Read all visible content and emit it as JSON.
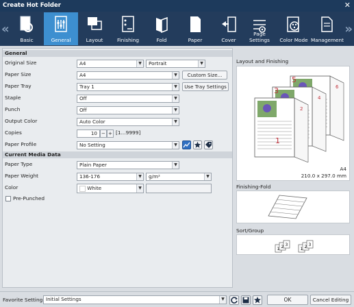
{
  "window": {
    "title": "Create Hot Folder"
  },
  "toolbar": {
    "items": [
      {
        "label": "Basic"
      },
      {
        "label": "General"
      },
      {
        "label": "Layout"
      },
      {
        "label": "Finishing"
      },
      {
        "label": "Fold"
      },
      {
        "label": "Paper"
      },
      {
        "label": "Cover"
      },
      {
        "label": "Page Settings"
      },
      {
        "label": "Color Mode"
      },
      {
        "label": "Management"
      }
    ],
    "active": "General"
  },
  "general": {
    "heading": "General",
    "original_size": {
      "label": "Original Size",
      "value": "A4",
      "orientation": "Portrait"
    },
    "paper_size": {
      "label": "Paper Size",
      "value": "A4",
      "button": "Custom Size..."
    },
    "paper_tray": {
      "label": "Paper Tray",
      "value": "Tray 1",
      "button": "Use Tray Settings"
    },
    "staple": {
      "label": "Staple",
      "value": "Off"
    },
    "punch": {
      "label": "Punch",
      "value": "Off"
    },
    "output_color": {
      "label": "Output Color",
      "value": "Auto Color"
    },
    "copies": {
      "label": "Copies",
      "value": "10",
      "minus": "−",
      "plus": "+",
      "range": "[1...9999]"
    },
    "paper_profile": {
      "label": "Paper Profile",
      "value": "No Setting"
    }
  },
  "media": {
    "heading": "Current Media Data",
    "paper_type": {
      "label": "Paper Type",
      "value": "Plain Paper"
    },
    "paper_weight": {
      "label": "Paper Weight",
      "value": "136-176",
      "unit": "g/m²"
    },
    "color": {
      "label": "Color",
      "value": "White"
    },
    "pre_punched": {
      "label": "Pre-Punched",
      "checked": false
    }
  },
  "preview": {
    "layout_title": "Layout and Finishing",
    "page_numbers": [
      "1",
      "2",
      "3",
      "4",
      "5",
      "6"
    ],
    "paper_name": "A4",
    "paper_dims": "210.0 x 297.0 mm",
    "fold_title": "Finishing-Fold",
    "sort_title": "Sort/Group",
    "sort_numbers": [
      "1",
      "2",
      "3",
      "1",
      "2",
      "3"
    ]
  },
  "footer": {
    "favorite_label": "Favorite Setting",
    "favorite_value": "Initial Settings",
    "ok": "OK",
    "cancel": "Cancel Editing"
  },
  "colors": {
    "titlebar": "#1d3a5c",
    "toolbar": "#233c5c",
    "active_tab": "#3d8fd0",
    "page_number": "#c0303a",
    "profile_button": "#2f6fc2"
  }
}
